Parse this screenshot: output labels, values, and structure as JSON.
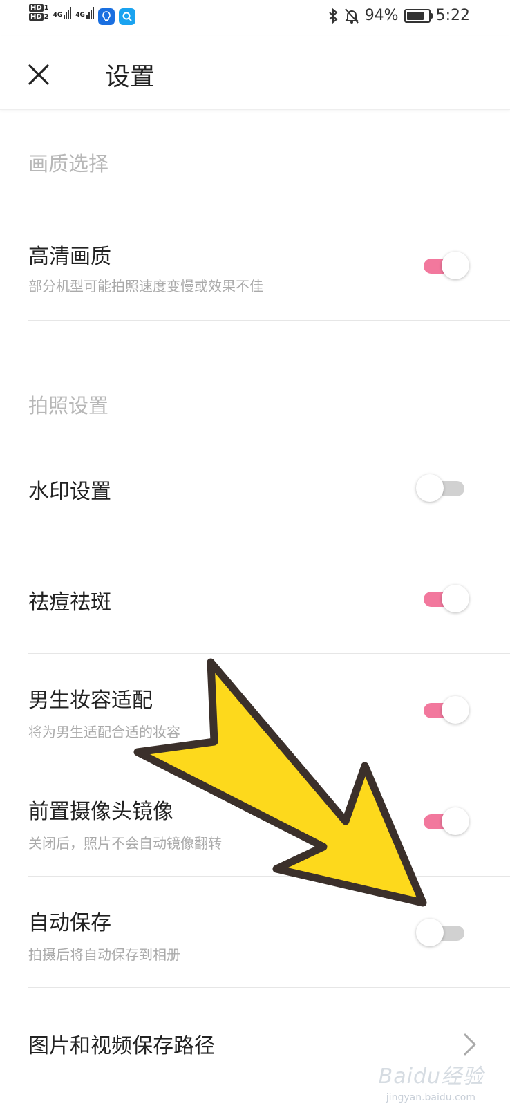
{
  "status_bar": {
    "sim1": "HD",
    "sim1_num": "1",
    "sim2": "HD",
    "sim2_num": "2",
    "net1": "4G",
    "net2": "4G",
    "battery_pct": "94%",
    "battery_level": 0.94,
    "time": "5:22",
    "icons": [
      "bluetooth-icon",
      "mute-bell-icon",
      "battery-icon",
      "lightbulb-app-icon",
      "search-app-icon"
    ]
  },
  "header": {
    "title": "设置"
  },
  "sections": [
    {
      "title": "画质选择",
      "items": [
        {
          "title": "高清画质",
          "subtitle": "部分机型可能拍照速度变慢或效果不佳",
          "on": true
        }
      ]
    },
    {
      "title": "拍照设置",
      "items": [
        {
          "title": "水印设置",
          "subtitle": "",
          "on": false
        },
        {
          "title": "祛痘祛斑",
          "subtitle": "",
          "on": true
        },
        {
          "title": "男生妆容适配",
          "subtitle": "将为男生适配合适的妆容",
          "on": true
        },
        {
          "title": "前置摄像头镜像",
          "subtitle": "关闭后，照片不会自动镜像翻转",
          "on": true
        },
        {
          "title": "自动保存",
          "subtitle": "拍摄后将自动保存到相册",
          "on": false
        },
        {
          "title": "图片和视频保存路径",
          "subtitle": ""
        }
      ]
    }
  ],
  "colors": {
    "toggle_on": "#f2789d",
    "toggle_off": "#d1d1d1",
    "arrow_fill": "#fdd91c",
    "arrow_stroke": "#3b302b"
  },
  "watermark": {
    "text": "Baidu经验",
    "sub": "jingyan.baidu.com"
  }
}
